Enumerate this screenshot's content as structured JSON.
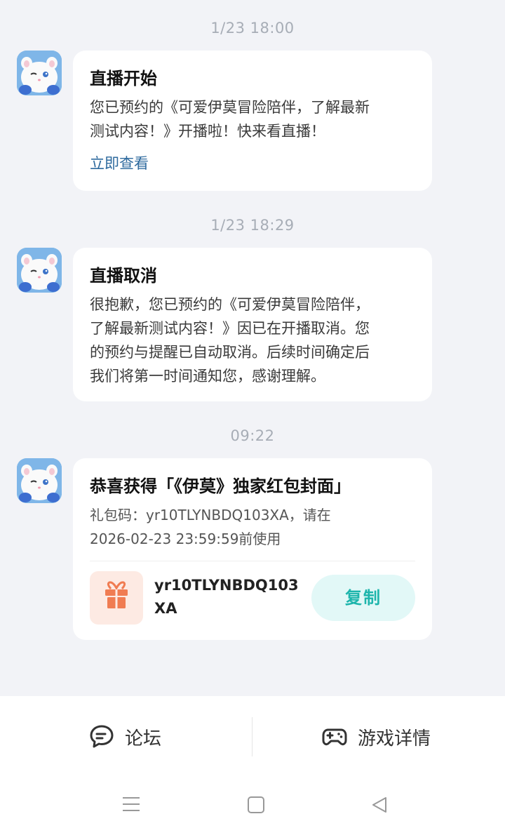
{
  "messages": [
    {
      "time": "1/23  18:00",
      "title": "直播开始",
      "lines": [
        "您已预约的《可爱伊莫冒险陪伴，了解最新",
        "测试内容！》开播啦！快来看直播！"
      ],
      "link": "立即查看"
    },
    {
      "time": "1/23  18:29",
      "title": "直播取消",
      "lines": [
        "很抱歉，您已预约的《可爱伊莫冒险陪伴，",
        "了解最新测试内容！》因已在开播取消。您",
        "的预约与提醒已自动取消。后续时间确定后",
        "我们将第一时间通知您，感谢理解。"
      ]
    },
    {
      "time": "09:22",
      "title": "恭喜获得「《伊莫》独家红包封面」",
      "lines": [
        "礼包码：yr10TLYNBDQ103XA，请在",
        "2026-02-23 23:59:59前使用"
      ],
      "code_lines": [
        "yr10TLYNBDQ103",
        "XA"
      ],
      "copy_label": "复制"
    }
  ],
  "bottom": {
    "forum_label": "论坛",
    "game_label": "游戏详情"
  },
  "icons": {
    "avatar": "cat-avatar-icon",
    "gift": "gift-icon",
    "forum": "chat-bubble-icon",
    "game": "gamepad-icon",
    "nav_menu": "menu-icon",
    "nav_home": "home-square-icon",
    "nav_back": "back-triangle-icon"
  },
  "colors": {
    "background": "#F2F3F7",
    "link": "#2E6A9E",
    "copy_text": "#1EB5AC",
    "copy_bg": "#E2F8F7",
    "gift": "#F07C52"
  }
}
